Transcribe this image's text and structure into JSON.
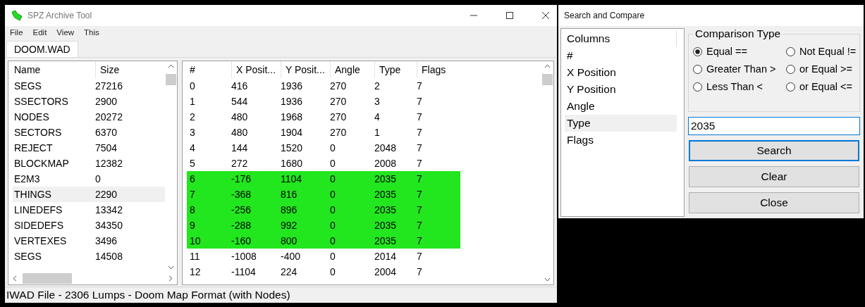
{
  "window": {
    "title": "SPZ Archive Tool"
  },
  "menu": [
    "File",
    "Edit",
    "View",
    "This"
  ],
  "tabs": [
    {
      "label": "DOOM.WAD",
      "selected": true
    }
  ],
  "lumps": {
    "columns": [
      "Name",
      "Size"
    ],
    "rows": [
      {
        "name": "SEGS",
        "size": "27216",
        "selected": false
      },
      {
        "name": "SSECTORS",
        "size": "2900",
        "selected": false
      },
      {
        "name": "NODES",
        "size": "20272",
        "selected": false
      },
      {
        "name": "SECTORS",
        "size": "6370",
        "selected": false
      },
      {
        "name": "REJECT",
        "size": "7504",
        "selected": false
      },
      {
        "name": "BLOCKMAP",
        "size": "12382",
        "selected": false
      },
      {
        "name": "E2M3",
        "size": "0",
        "selected": false
      },
      {
        "name": "THINGS",
        "size": "2290",
        "selected": true
      },
      {
        "name": "LINEDEFS",
        "size": "13342",
        "selected": false
      },
      {
        "name": "SIDEDEFS",
        "size": "34350",
        "selected": false
      },
      {
        "name": "VERTEXES",
        "size": "3496",
        "selected": false
      },
      {
        "name": "SEGS",
        "size": "14508",
        "selected": false
      }
    ]
  },
  "things": {
    "columns": [
      "#",
      "X Posit...",
      "Y Posit...",
      "Angle",
      "Type",
      "Flags"
    ],
    "rows": [
      {
        "cells": [
          "0",
          "416",
          "1936",
          "270",
          "2",
          "7"
        ],
        "highlighted": false
      },
      {
        "cells": [
          "1",
          "544",
          "1936",
          "270",
          "3",
          "7"
        ],
        "highlighted": false
      },
      {
        "cells": [
          "2",
          "480",
          "1968",
          "270",
          "4",
          "7"
        ],
        "highlighted": false
      },
      {
        "cells": [
          "3",
          "480",
          "1904",
          "270",
          "1",
          "7"
        ],
        "highlighted": false
      },
      {
        "cells": [
          "4",
          "144",
          "1520",
          "0",
          "2048",
          "7"
        ],
        "highlighted": false
      },
      {
        "cells": [
          "5",
          "272",
          "1680",
          "0",
          "2008",
          "7"
        ],
        "highlighted": false
      },
      {
        "cells": [
          "6",
          "-176",
          "1104",
          "0",
          "2035",
          "7"
        ],
        "highlighted": true
      },
      {
        "cells": [
          "7",
          "-368",
          "816",
          "0",
          "2035",
          "7"
        ],
        "highlighted": true
      },
      {
        "cells": [
          "8",
          "-256",
          "896",
          "0",
          "2035",
          "7"
        ],
        "highlighted": true
      },
      {
        "cells": [
          "9",
          "-288",
          "992",
          "0",
          "2035",
          "7"
        ],
        "highlighted": true
      },
      {
        "cells": [
          "10",
          "-160",
          "800",
          "0",
          "2035",
          "7"
        ],
        "highlighted": true
      },
      {
        "cells": [
          "11",
          "-1008",
          "-400",
          "0",
          "2014",
          "7"
        ],
        "highlighted": false
      },
      {
        "cells": [
          "12",
          "-1104",
          "224",
          "0",
          "2004",
          "7"
        ],
        "highlighted": false
      }
    ]
  },
  "status_bar": "IWAD File - 2306 Lumps - Doom Map Format (with Nodes)",
  "dialog": {
    "title": "Search and Compare",
    "columns_header": "Columns",
    "columns": [
      {
        "label": "#",
        "selected": false
      },
      {
        "label": "X Position",
        "selected": false
      },
      {
        "label": "Y Position",
        "selected": false
      },
      {
        "label": "Angle",
        "selected": false
      },
      {
        "label": "Type",
        "selected": true
      },
      {
        "label": "Flags",
        "selected": false
      }
    ],
    "group_title": "Comparison Type",
    "options": [
      {
        "label": "Equal  ==",
        "selected": true
      },
      {
        "label": "Not Equal  !=",
        "selected": false
      },
      {
        "label": "Greater Than >",
        "selected": false
      },
      {
        "label": "or Equal >=",
        "selected": false
      },
      {
        "label": "Less Than <",
        "selected": false
      },
      {
        "label": "or Equal <=",
        "selected": false
      }
    ],
    "value": "2035",
    "buttons": [
      {
        "label": "Search",
        "focused": true
      },
      {
        "label": "Clear",
        "focused": false
      },
      {
        "label": "Close",
        "focused": false
      }
    ]
  }
}
